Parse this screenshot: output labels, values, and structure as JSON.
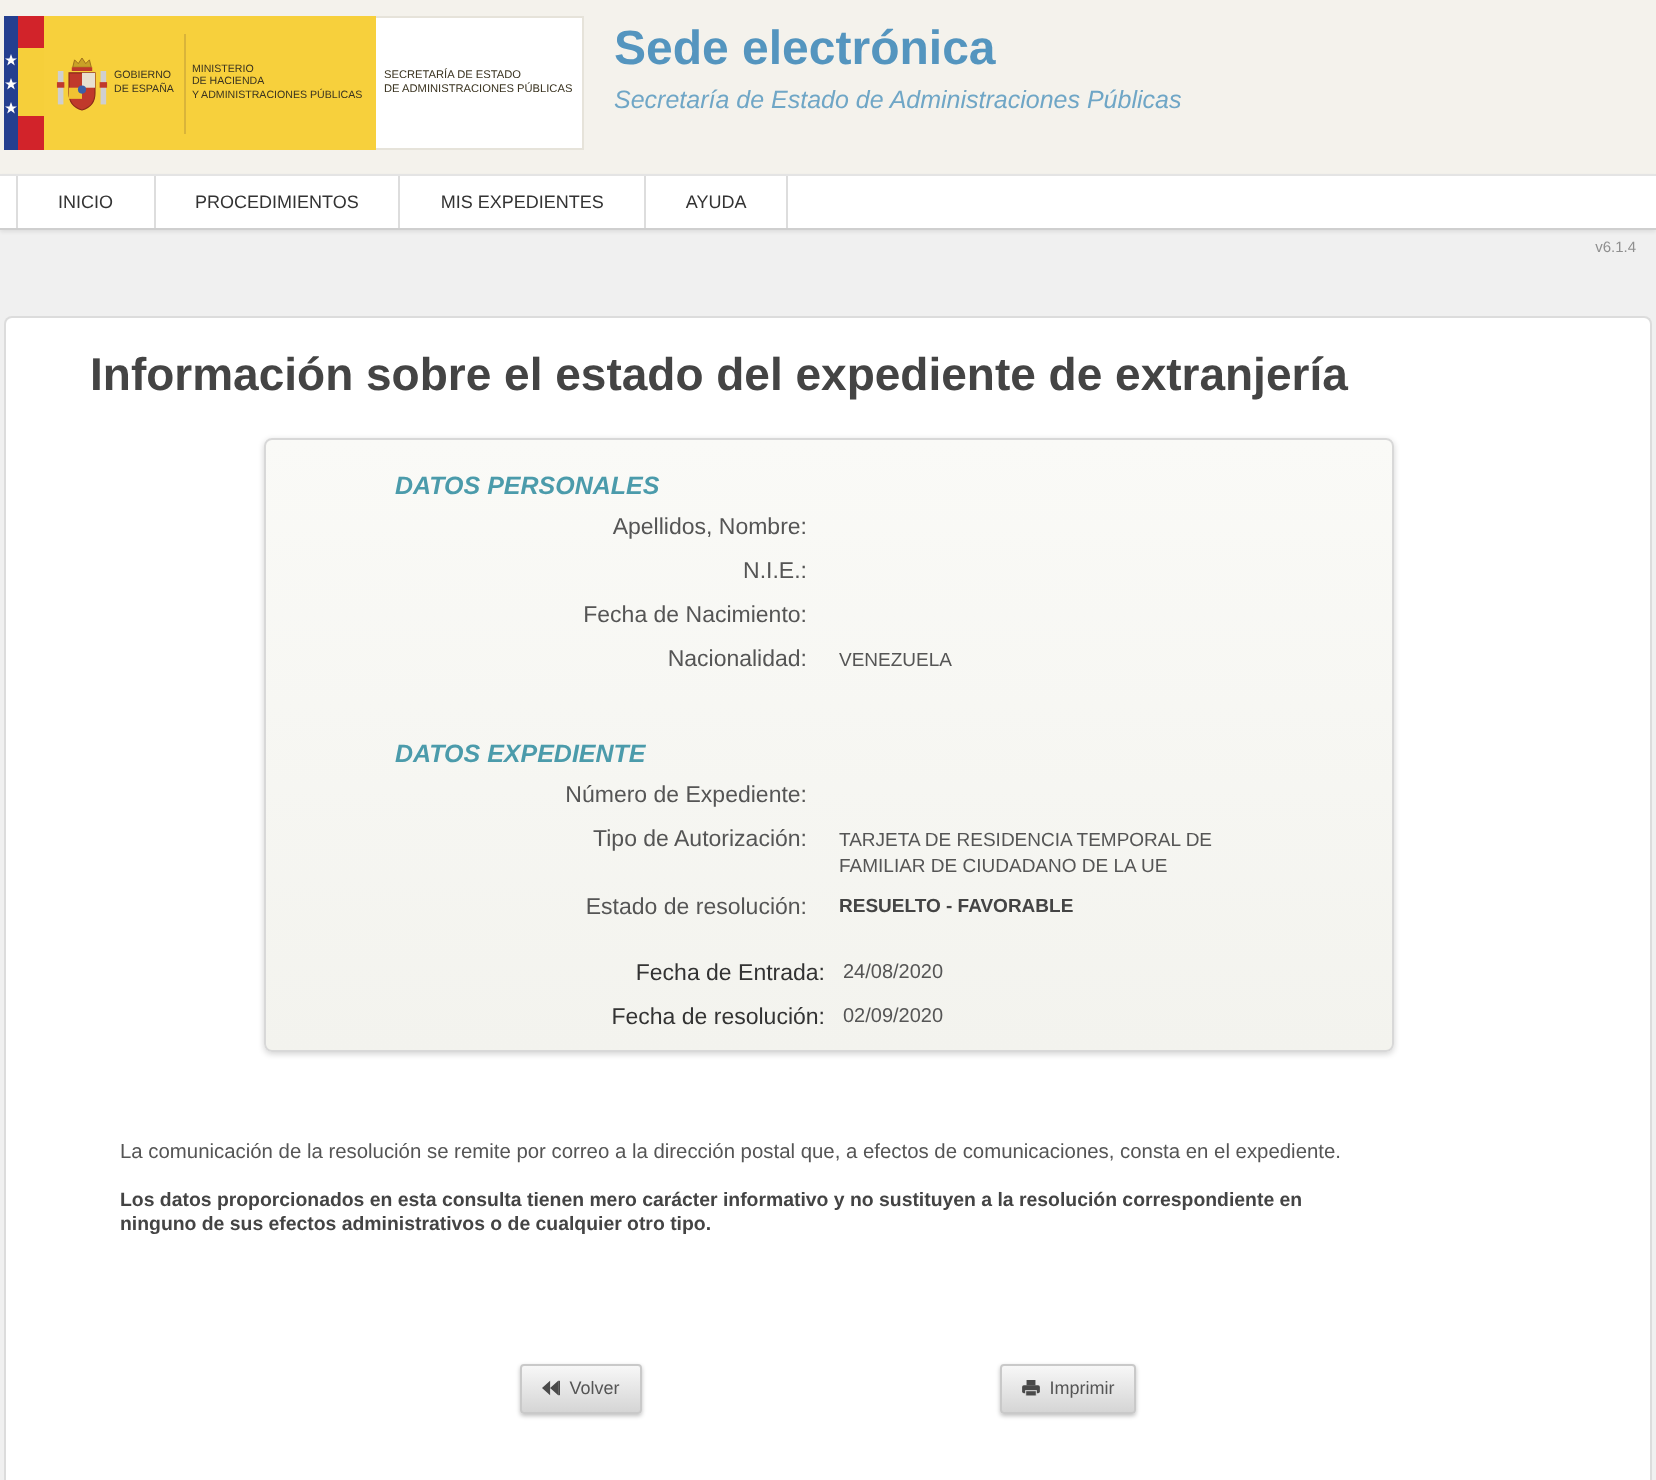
{
  "header": {
    "logo": {
      "government": [
        "GOBIERNO",
        "DE ESPAÑA"
      ],
      "ministry": [
        "MINISTERIO",
        "DE HACIENDA",
        "Y ADMINISTRACIONES PÚBLICAS"
      ],
      "secretariat": [
        "SECRETARÍA DE ESTADO",
        "DE ADMINISTRACIONES PÚBLICAS"
      ]
    },
    "title": "Sede electrónica",
    "subtitle": "Secretaría de Estado de Administraciones Públicas"
  },
  "nav": [
    {
      "label": "INICIO",
      "selected": false
    },
    {
      "label": "PROCEDIMIENTOS",
      "selected": false
    },
    {
      "label": "MIS EXPEDIENTES",
      "selected": false
    },
    {
      "label": "AYUDA",
      "selected": false
    }
  ],
  "version": "v6.1.4",
  "page_title": "Información sobre el estado del expediente de extranjería",
  "sections": [
    {
      "title": "DATOS PERSONALES",
      "rows": [
        {
          "label": "Apellidos, Nombre:",
          "kind": "empty"
        },
        {
          "label": "N.I.E.:",
          "kind": "empty"
        },
        {
          "label": "Fecha de Nacimiento:",
          "kind": "empty"
        },
        {
          "label": "Nacionalidad:",
          "kind": "text",
          "value": "VENEZUELA"
        }
      ]
    },
    {
      "title": "DATOS EXPEDIENTE",
      "rows": [
        {
          "label": "Número de Expediente:",
          "kind": "empty"
        },
        {
          "label": "Tipo de Autorización:",
          "kind": "text",
          "value": "TARJETA DE RESIDENCIA TEMPORAL DE FAMILIAR DE CIUDADANO DE LA UE"
        },
        {
          "label": "Estado de resolución:",
          "kind": "strong",
          "value": "RESUELTO - FAVORABLE"
        }
      ]
    }
  ],
  "dates": [
    {
      "label": "Fecha de Entrada:",
      "value": "24/08/2020"
    },
    {
      "label": "Fecha de resolución:",
      "value": "02/09/2020"
    }
  ],
  "notes": [
    {
      "kind": "plain",
      "text": "La comunicación de la resolución se remite por correo a la dirección postal que, a efectos de comunicaciones, consta en el expediente."
    },
    {
      "kind": "strong",
      "text": "Los datos proporcionados en esta consulta tienen mero carácter informativo y no sustituyen a la resolución correspondiente en ninguno de sus efectos administrativos o de cualquier otro tipo."
    }
  ],
  "buttons": [
    {
      "kind": "back",
      "label": "Volver"
    },
    {
      "kind": "print",
      "label": "Imprimir"
    }
  ]
}
